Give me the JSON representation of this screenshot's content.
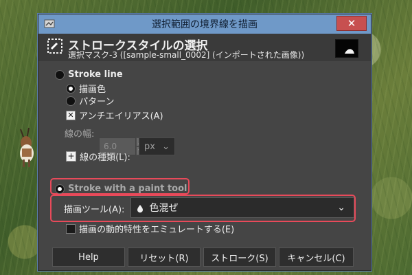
{
  "window": {
    "title": "選択範囲の境界線を描画"
  },
  "header": {
    "title": "ストロークスタイルの選択",
    "subtitle": "選択マスク-3 ([sample-small_0002] (インポートされた画像))"
  },
  "options": {
    "stroke_line_label": "Stroke line",
    "solid_color_label": "描画色",
    "pattern_label": "パターン",
    "antialias_label": "アンチエイリアス(A)",
    "line_width_label": "線の幅:",
    "line_width_value": "6.0",
    "unit_value": "px",
    "line_style_label": "線の種類(L):",
    "paint_tool_label": "Stroke with a paint tool",
    "paint_tool_field_label": "描画ツール(A):",
    "paint_tool_value": "色混ぜ",
    "emulate_label": "描画の動的特性をエミュレートする(E)"
  },
  "buttons": {
    "help": "Help",
    "reset": "リセット(R)",
    "stroke": "ストローク(S)",
    "cancel": "キャンセル(C)"
  },
  "icons": {
    "close": "close-icon",
    "dropdown": "chevron-down-icon",
    "header": "stroke-selection-icon",
    "paint_drop": "water-drop-icon"
  },
  "colors": {
    "highlight": "#e84a5a",
    "titlebar": "#6f99c8",
    "dialog": "#454545"
  }
}
